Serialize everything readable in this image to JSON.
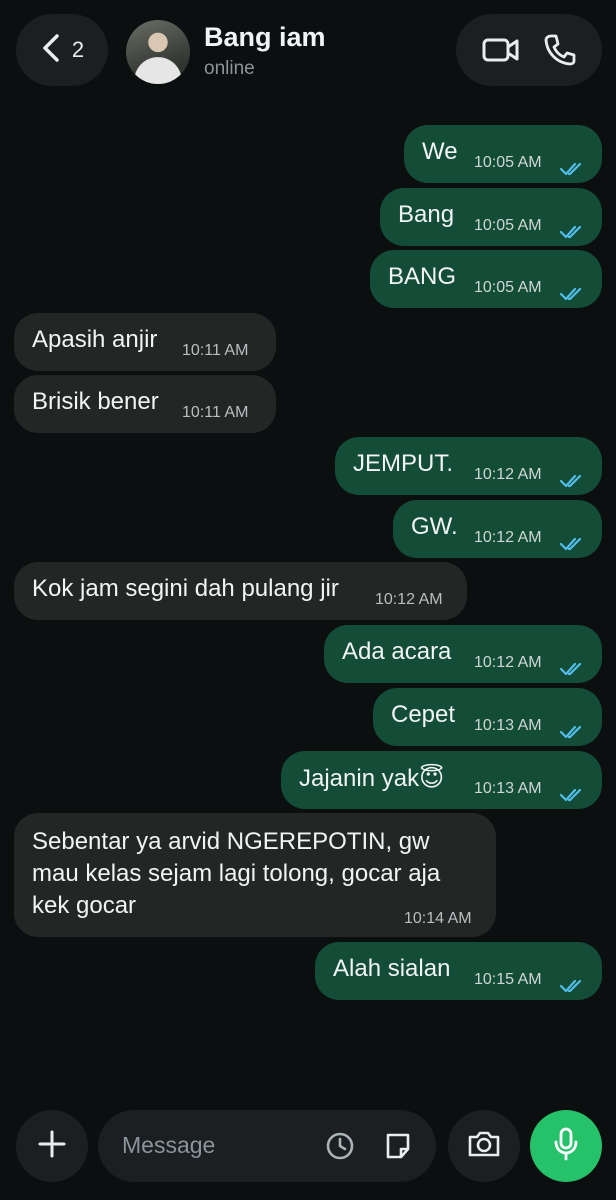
{
  "header": {
    "back_count": "2",
    "contact_name": "Bang iam",
    "contact_status": "online"
  },
  "messages": [
    {
      "dir": "out",
      "text": "We",
      "time": "10:05 AM",
      "read": true
    },
    {
      "dir": "out",
      "text": "Bang",
      "time": "10:05 AM",
      "read": true
    },
    {
      "dir": "out",
      "text": "BANG",
      "time": "10:05 AM",
      "read": true
    },
    {
      "dir": "in",
      "text": "Apasih anjir",
      "time": "10:11 AM"
    },
    {
      "dir": "in",
      "text": "Brisik bener",
      "time": "10:11 AM"
    },
    {
      "dir": "out",
      "text": "JEMPUT.",
      "time": "10:12 AM",
      "read": true
    },
    {
      "dir": "out",
      "text": "GW.",
      "time": "10:12 AM",
      "read": true
    },
    {
      "dir": "in",
      "text": "Kok jam segini dah pulang jir",
      "time": "10:12 AM"
    },
    {
      "dir": "out",
      "text": "Ada acara",
      "time": "10:12 AM",
      "read": true
    },
    {
      "dir": "out",
      "text": "Cepet",
      "time": "10:13 AM",
      "read": true
    },
    {
      "dir": "out",
      "text": "Jajanin yak😇",
      "time": "10:13 AM",
      "read": true
    },
    {
      "dir": "in",
      "text": "Sebentar ya arvid NGEREPOTIN, gw mau kelas sejam lagi tolong, gocar aja kek gocar",
      "time": "10:14 AM"
    },
    {
      "dir": "out",
      "text": "Alah sialan",
      "time": "10:15 AM",
      "read": true
    }
  ],
  "composer": {
    "placeholder": "Message"
  },
  "colors": {
    "background": "#0b0f10",
    "outgoing_bubble": "#134d37",
    "incoming_bubble": "#242626",
    "read_ticks": "#53bdeb",
    "mic_button": "#25c26a"
  },
  "icons": [
    "back-arrow-icon",
    "video-call-icon",
    "voice-call-icon",
    "plus-icon",
    "clock-icon",
    "sticker-icon",
    "camera-icon",
    "mic-icon",
    "read-ticks-icon"
  ]
}
